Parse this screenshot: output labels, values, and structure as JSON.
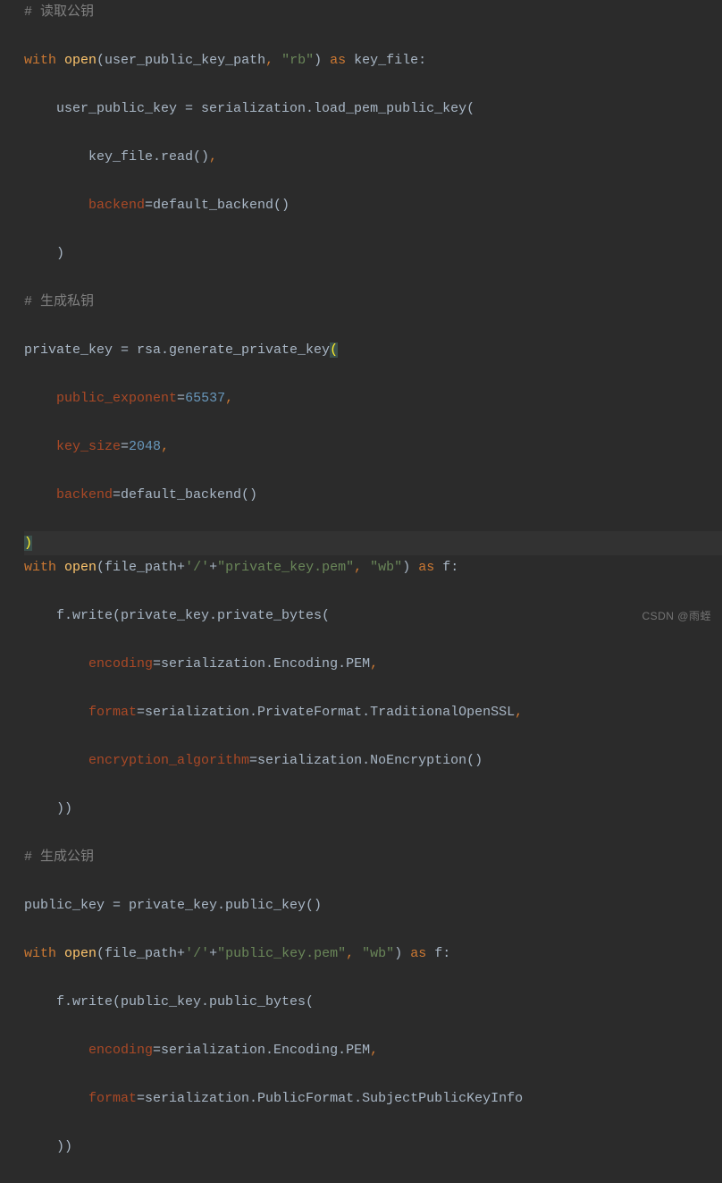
{
  "watermark": "CSDN @雨蛭",
  "code": {
    "l1": "# 读取公钥",
    "l2_with": "with",
    "l2_open": "open",
    "l2_p1": "(user_public_key_path",
    "l2_c1": ",",
    "l2_s1": "\"rb\"",
    "l2_p2": ") ",
    "l2_as": "as",
    "l2_p3": " key_file:",
    "l3": "    user_public_key = serialization.load_pem_public_key(",
    "l4": "        key_file.read()",
    "l4_c": ",",
    "l5_pad": "        ",
    "l5_backend": "backend",
    "l5_rest": "=default_backend()",
    "l6": "    )",
    "l7": "# 生成私钥",
    "l8_a": "private_key = rsa.generate_private_key",
    "l8_paren": "(",
    "l9_pad": "    ",
    "l9_pe": "public_exponent",
    "l9_eq": "=",
    "l9_num": "65537",
    "l9_c": ",",
    "l10_pad": "    ",
    "l10_ks": "key_size",
    "l10_eq": "=",
    "l10_num": "2048",
    "l10_c": ",",
    "l11_pad": "    ",
    "l11_backend": "backend",
    "l11_rest": "=default_backend()",
    "l12_paren": ")",
    "l13_with": "with",
    "l13_open": "open",
    "l13_a": "(file_path+",
    "l13_s1": "'/'",
    "l13_plus": "+",
    "l13_s2": "\"private_key.pem\"",
    "l13_c1": ",",
    "l13_sp1": " ",
    "l13_s3": "\"wb\"",
    "l13_b": ") ",
    "l13_as": "as",
    "l13_c": " f:",
    "l14": "    f.write(private_key.private_bytes(",
    "l15_pad": "        ",
    "l15_enc": "encoding",
    "l15_rest": "=serialization.Encoding.PEM",
    "l15_c": ",",
    "l16_pad": "        ",
    "l16_fmt": "format",
    "l16_rest": "=serialization.PrivateFormat.TraditionalOpenSSL",
    "l16_c": ",",
    "l17_pad": "        ",
    "l17_ea": "encryption_algorithm",
    "l17_rest": "=serialization.NoEncryption()",
    "l18": "    ))",
    "l19": "# 生成公钥",
    "l20": "public_key = private_key.public_key()",
    "l21_with": "with",
    "l21_open": "open",
    "l21_a": "(file_path+",
    "l21_s1": "'/'",
    "l21_plus": "+",
    "l21_s2": "\"public_key.pem\"",
    "l21_c1": ",",
    "l21_sp1": " ",
    "l21_s3": "\"wb\"",
    "l21_b": ") ",
    "l21_as": "as",
    "l21_c": " f:",
    "l22": "    f.write(public_key.public_bytes(",
    "l23_pad": "        ",
    "l23_enc": "encoding",
    "l23_rest": "=serialization.Encoding.PEM",
    "l23_c": ",",
    "l24_pad": "        ",
    "l24_fmt": "format",
    "l24_rest": "=serialization.PublicFormat.SubjectPublicKeyInfo",
    "l25": "    ))"
  }
}
